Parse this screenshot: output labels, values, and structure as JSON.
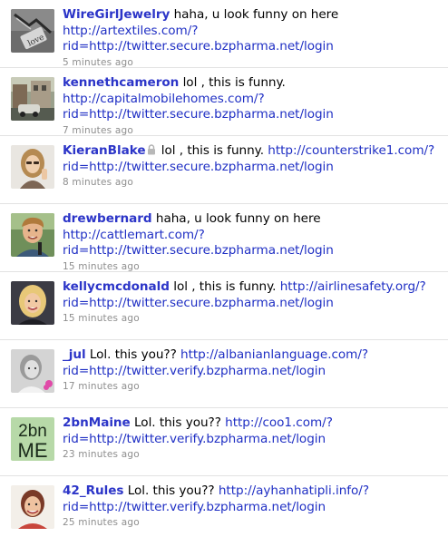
{
  "tweets": [
    {
      "screen_name": "WireGirlJewelry",
      "text": "haha, u look funny on here",
      "link1": "http://artextiles.com/?",
      "link2": "rid=http://twitter.secure.bzpharma.net/login",
      "time": "5 minutes ago",
      "protected": false,
      "avatar_icon": "chain-love-pendant-photo"
    },
    {
      "screen_name": "kennethcameron",
      "text": "lol , this is funny.",
      "link1": "http://capitalmobilehomes.com/?",
      "link2": "rid=http://twitter.secure.bzpharma.net/login",
      "time": "7 minutes ago",
      "protected": false,
      "avatar_icon": "street-scene-photo"
    },
    {
      "screen_name": "KieranBlake",
      "text": "lol , this is funny.",
      "link1": "http://counterstrike1.com/?",
      "link2": "rid=http://twitter.secure.bzpharma.net/login",
      "time": "8 minutes ago",
      "protected": true,
      "avatar_icon": "woman-portrait-photo"
    },
    {
      "screen_name": "drewbernard",
      "text": "haha, u look funny on here",
      "link1": "http://cattlemart.com/?",
      "link2": "rid=http://twitter.secure.bzpharma.net/login",
      "time": "15 minutes ago",
      "protected": false,
      "avatar_icon": "man-portrait-photo"
    },
    {
      "screen_name": "kellycmcdonald",
      "text": "lol , this is funny.",
      "link1": "http://airlinesafety.org/?",
      "link2": "rid=http://twitter.secure.bzpharma.net/login",
      "time": "15 minutes ago",
      "protected": false,
      "avatar_icon": "blonde-woman-portrait-photo"
    },
    {
      "screen_name": "_jul",
      "text": "Lol. this you??",
      "link1": "http://albanianlanguage.com/?",
      "link2": "rid=http://twitter.verify.bzpharma.net/login",
      "time": "17 minutes ago",
      "protected": false,
      "avatar_icon": "woman-grayscale-photo"
    },
    {
      "screen_name": "2bnMaine",
      "text": "Lol. this you??",
      "link1": "http://coo1.com/?",
      "link2": "rid=http://twitter.verify.bzpharma.net/login",
      "time": "23 minutes ago",
      "protected": false,
      "avatar_icon": "2bn-me-logo",
      "avatar_text_top": "2bn",
      "avatar_text_bottom": "ME"
    },
    {
      "screen_name": "42_Rules",
      "text": "Lol. this you??",
      "link1": "http://ayhanhatipli.info/?",
      "link2": "rid=http://twitter.verify.bzpharma.net/login",
      "time": "25 minutes ago",
      "protected": false,
      "avatar_icon": "smiling-woman-portrait-photo"
    }
  ],
  "colors": {
    "screen_name": "#2c35c8",
    "link": "#1f2fc4",
    "timestamp": "#8e8e8e",
    "divider": "#e2e2e2"
  }
}
